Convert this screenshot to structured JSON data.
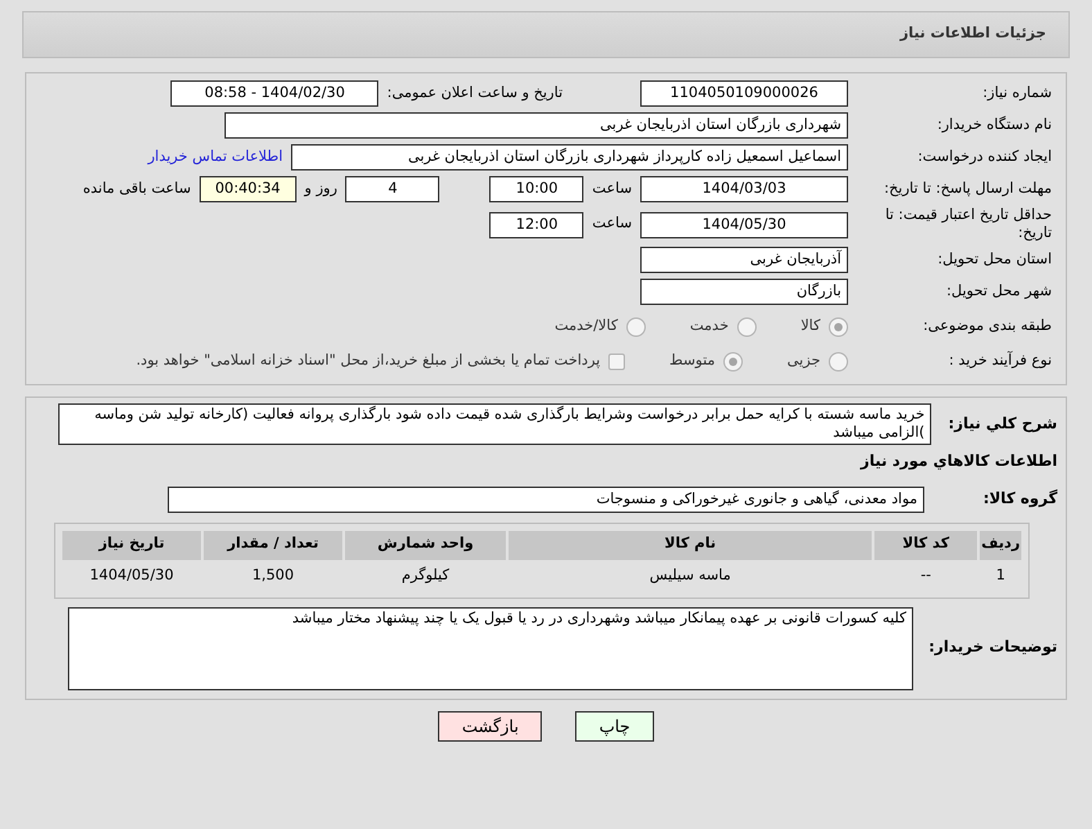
{
  "header": {
    "title": "جزئیات اطلاعات نیاز"
  },
  "need_number": {
    "label": "شماره نیاز:",
    "value": "1104050109000026"
  },
  "announce": {
    "label": "تاریخ و ساعت اعلان عمومی:",
    "value": "1404/02/30 - 08:58"
  },
  "buyer_org": {
    "label": "نام دستگاه خریدار:",
    "value": "شهرداری بازرگان استان اذربایجان غربی"
  },
  "requester": {
    "label": "ایجاد کننده درخواست:",
    "value": "اسماعیل اسمعیل زاده کارپرداز شهرداری بازرگان استان اذربایجان غربی",
    "link": "اطلاعات تماس خریدار"
  },
  "reply_deadline": {
    "label": "مهلت ارسال پاسخ: تا تاریخ:",
    "date": "1404/03/03",
    "time_label": "ساعت",
    "time": "10:00",
    "days": "4",
    "days_label": "روز و",
    "remaining": "00:40:34",
    "remaining_label": "ساعت باقی مانده"
  },
  "price_validity": {
    "label": "حداقل تاریخ اعتبار قیمت: تا تاریخ:",
    "date": "1404/05/30",
    "time_label": "ساعت",
    "time": "12:00"
  },
  "delivery_province": {
    "label": "استان محل تحویل:",
    "value": "آذربایجان غربی"
  },
  "delivery_city": {
    "label": "شهر محل تحویل:",
    "value": "بازرگان"
  },
  "category": {
    "label": "طبقه بندی موضوعی:",
    "options": [
      {
        "label": "کالا",
        "selected": true
      },
      {
        "label": "خدمت",
        "selected": false
      },
      {
        "label": "کالا/خدمت",
        "selected": false
      }
    ]
  },
  "purchase_process": {
    "label": "نوع فرآیند خرید :",
    "options": [
      {
        "label": "جزیی",
        "selected": false
      },
      {
        "label": "متوسط",
        "selected": true
      }
    ],
    "treasury": {
      "label": "پرداخت تمام یا بخشی از مبلغ خرید،از محل \"اسناد خزانه اسلامی\" خواهد بود.",
      "checked": false
    }
  },
  "description": {
    "label": "شرح کلي نیاز:",
    "value": "خرید ماسه شسته با کرایه حمل  برابر درخواست وشرایط بارگذاری شده قیمت داده شود بارگذاری پروانه فعالیت (کارخانه تولید شن وماسه )الزامی میباشد"
  },
  "goods_heading": "اطلاعات کالاهاي مورد نياز",
  "goods_group": {
    "label": "گروه کالا:",
    "value": "مواد معدنی، گیاهی و جانوری غیرخوراکی و منسوجات"
  },
  "table": {
    "columns": [
      "ردیف",
      "کد کالا",
      "نام کالا",
      "واحد شمارش",
      "تعداد / مقدار",
      "تاریخ نیاز"
    ],
    "rows": [
      [
        "1",
        "--",
        "ماسه سیلیس",
        "کیلوگرم",
        "1,500",
        "1404/05/30"
      ]
    ]
  },
  "buyer_notes": {
    "label": "توضیحات خریدار:",
    "value": "کلیه کسورات قانونی بر عهده پیمانکار میباشد وشهرداری در رد یا قبول یک یا چند پیشنهاد مختار میباشد"
  },
  "buttons": [
    {
      "label": "چاپ",
      "kind": "print"
    },
    {
      "label": "بازگشت",
      "kind": "back"
    }
  ]
}
